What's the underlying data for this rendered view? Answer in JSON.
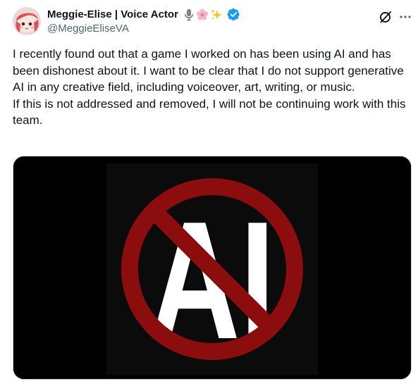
{
  "author": {
    "display_name": "Meggie-Elise | Voice Actor",
    "name_emojis": [
      "microphone-icon",
      "cherry-blossom-icon",
      "sparkles-icon"
    ],
    "verified": true,
    "handle": "@MeggieEliseVA"
  },
  "actions": {
    "grok_icon": "grok-icon",
    "more_icon": "more-icon"
  },
  "tweet": {
    "paragraphs": [
      "I recently found out that a game I worked on has been using AI and has been dishonest about it. I want to be clear that I do not support generative AI in any creative field, including voiceover, art, writing, or music.",
      "If this is not addressed and removed, I will not be continuing work with this team."
    ]
  },
  "media": {
    "image_text": "AI",
    "symbol": "no-ai-prohibition-sign",
    "colors": {
      "background": "#000000",
      "ring": "#8b0d0d",
      "letters": "#ffffff"
    }
  },
  "colors": {
    "verified": "#1d9bf0",
    "secondary_text": "#536471",
    "primary_text": "#0f1419"
  }
}
